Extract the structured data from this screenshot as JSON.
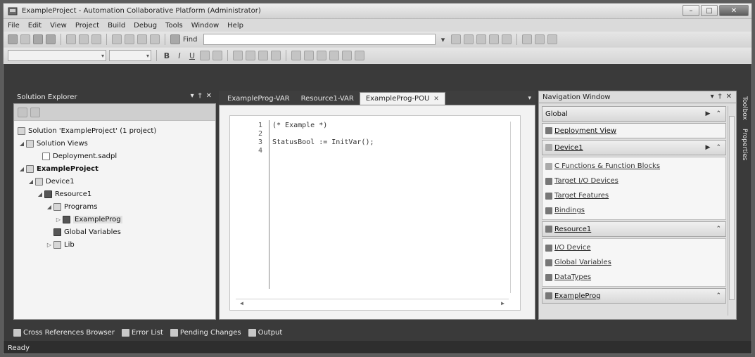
{
  "window": {
    "title": "ExampleProject - Automation Collaborative Platform (Administrator)"
  },
  "menu": [
    "File",
    "Edit",
    "View",
    "Project",
    "Build",
    "Debug",
    "Tools",
    "Window",
    "Help"
  ],
  "toolbar": {
    "find_label": "Find",
    "find_value": ""
  },
  "format_buttons": [
    "B",
    "I",
    "U"
  ],
  "solution_explorer": {
    "title": "Solution Explorer",
    "items": [
      {
        "label": "Solution 'ExampleProject' (1 project)"
      },
      {
        "label": "Solution Views"
      },
      {
        "label": "Deployment.sadpl"
      },
      {
        "label": "ExampleProject"
      },
      {
        "label": "Device1"
      },
      {
        "label": "Resource1"
      },
      {
        "label": "Programs"
      },
      {
        "label": "ExampleProg"
      },
      {
        "label": "Global Variables"
      },
      {
        "label": "Lib"
      }
    ]
  },
  "editor": {
    "tabs": [
      "ExampleProg-VAR",
      "Resource1-VAR",
      "ExampleProg-POU"
    ],
    "active_tab": "ExampleProg-POU",
    "lines": [
      {
        "num": "1",
        "text": "(* Example *)"
      },
      {
        "num": "2",
        "text": ""
      },
      {
        "num": "3",
        "text": "StatusBool := InitVar();"
      },
      {
        "num": "4",
        "text": ""
      }
    ]
  },
  "navigation": {
    "title": "Navigation Window",
    "sections": {
      "global": "Global",
      "deployment_view": "Deployment View",
      "device": "Device1",
      "device_links": [
        "C Functions & Function Blocks",
        "Target I/O Devices",
        "Target Features",
        "Bindings"
      ],
      "resource": "Resource1",
      "resource_links": [
        "I/O Device",
        "Global Variables",
        "DataTypes"
      ],
      "program": "ExampleProg"
    }
  },
  "side_tabs": [
    "Toolbox",
    "Properties"
  ],
  "bottom_tabs": [
    "Cross References Browser",
    "Error List",
    "Pending Changes",
    "Output"
  ],
  "status": "Ready"
}
